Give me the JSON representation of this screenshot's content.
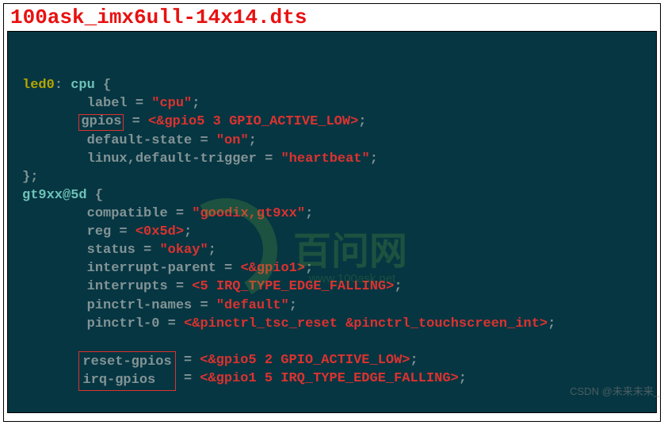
{
  "title": "100ask_imx6ull-14x14.dts",
  "led0": {
    "label_def": "led0",
    "node": "cpu",
    "label_prop": "label",
    "label_val": "\"cpu\"",
    "gpios_prop": "gpios",
    "gpios_val": "<&gpio5 3 GPIO_ACTIVE_LOW>",
    "default_state_prop": "default-state",
    "default_state_val": "\"on\"",
    "trigger_prop": "linux,default-trigger",
    "trigger_val": "\"heartbeat\""
  },
  "gt9xx": {
    "node": "gt9xx@5d",
    "compat_prop": "compatible",
    "compat_val": "\"goodix,gt9xx\"",
    "reg_prop": "reg",
    "reg_val": "<0x5d>",
    "status_prop": "status",
    "status_val": "\"okay\"",
    "int_parent_prop": "interrupt-parent",
    "int_parent_val": "<&gpio1>",
    "interrupts_prop": "interrupts",
    "interrupts_val": "<5 IRQ_TYPE_EDGE_FALLING>",
    "pinctrl_names_prop": "pinctrl-names",
    "pinctrl_names_val": "\"default\"",
    "pinctrl0_prop": "pinctrl-0",
    "pinctrl0_val": "<&pinctrl_tsc_reset &pinctrl_touchscreen_int>",
    "reset_gpios_prop": "reset-gpios",
    "reset_gpios_val": "<&gpio5 2 GPIO_ACTIVE_LOW>",
    "irq_gpios_prop": "irq-gpios",
    "irq_gpios_val": "<&gpio1 5 IRQ_TYPE_EDGE_FALLING>"
  },
  "watermark": "CSDN @未来未来_",
  "brand": "百问网",
  "brand_sub": "www.100ask.net"
}
